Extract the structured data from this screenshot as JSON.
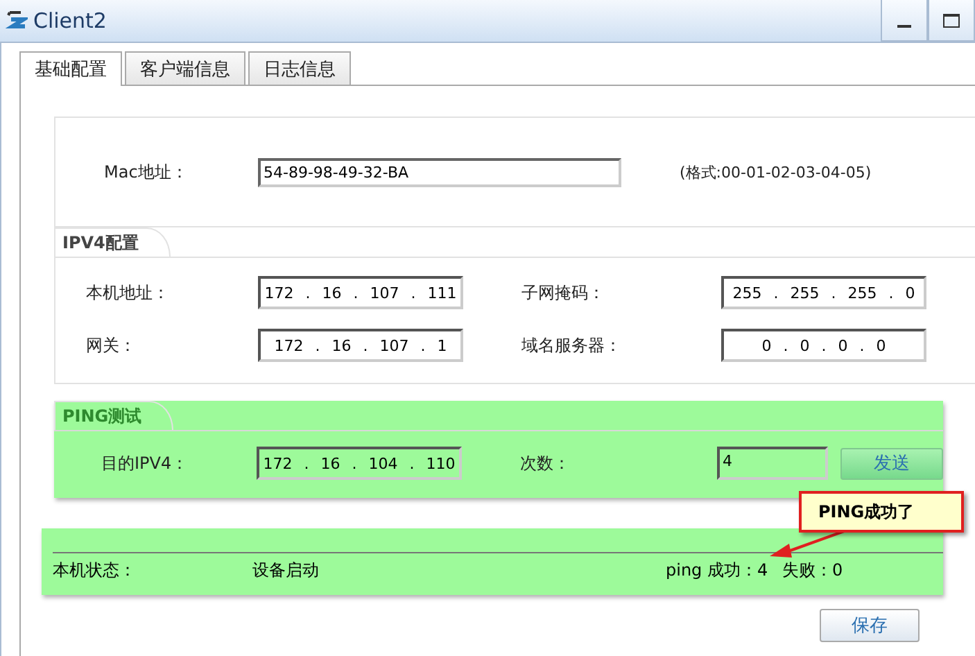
{
  "window": {
    "title": "Client2"
  },
  "tabs": [
    {
      "label": "基础配置",
      "selected": true
    },
    {
      "label": "客户端信息",
      "selected": false
    },
    {
      "label": "日志信息",
      "selected": false
    }
  ],
  "mac": {
    "label": "Mac地址：",
    "value": "54-89-98-49-32-BA",
    "hint": "(格式:00-01-02-03-04-05)"
  },
  "ipv4": {
    "title": "IPV4配置",
    "fields": [
      {
        "label": "本机地址：",
        "value": "172 . 16 . 107 . 111"
      },
      {
        "label": "子网掩码：",
        "value": "255 . 255 . 255 . 0"
      },
      {
        "label": "网关：",
        "value": "172 . 16 . 107 . 1"
      },
      {
        "label": "域名服务器：",
        "value": "0 . 0 . 0 . 0"
      }
    ]
  },
  "ping": {
    "title": "PING测试",
    "highlighted": true,
    "target_label": "目的IPV4：",
    "value": "172 . 16 . 104 . 110",
    "count_label": "次数：",
    "count": "4",
    "send_button": "发送"
  },
  "status": {
    "highlighted": true,
    "label": "本机状态：",
    "value": "设备启动",
    "success": "ping 成功：4",
    "failure": "失败：0"
  },
  "callout": {
    "text": "PING成功了"
  },
  "save_button": "保存"
}
